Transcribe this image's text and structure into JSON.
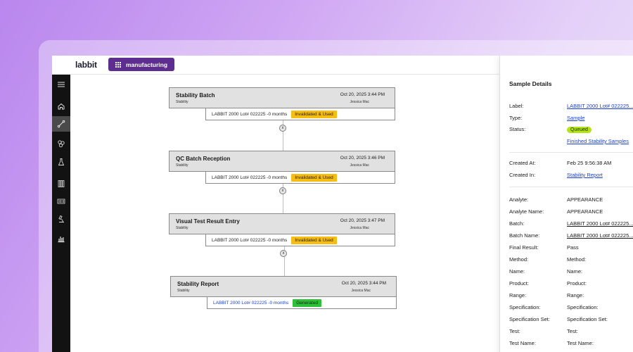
{
  "app": {
    "logo": "labbit",
    "workspace": "manufacturing"
  },
  "sidebar": {
    "items": [
      {
        "name": "menu-icon"
      },
      {
        "name": "home-icon"
      },
      {
        "name": "workflow-icon",
        "active": true
      },
      {
        "name": "molecule-icon"
      },
      {
        "name": "flask-icon"
      },
      {
        "name": "test-tubes-icon"
      },
      {
        "name": "barcode-icon"
      },
      {
        "name": "microscope-icon"
      },
      {
        "name": "report-chart-icon"
      }
    ]
  },
  "workflow": {
    "nodes": [
      {
        "title": "Stability Batch",
        "subtitle": "Stability",
        "date": "Oct 20, 2025 3:44 PM",
        "user": "Jessica Mac",
        "sample": "LABBIT 2000 Lot# 022225 -0 months",
        "status": "Invalidated & Used",
        "status_color": "#f6bd16"
      },
      {
        "title": "QC Batch Reception",
        "subtitle": "Stability",
        "date": "Oct 20, 2025 3:46 PM",
        "user": "Jessica Mac",
        "sample": "LABBIT 2000 Lot# 022225 -0 months",
        "status": "Invalidated & Used",
        "status_color": "#f6bd16"
      },
      {
        "title": "Visual Test Result Entry",
        "subtitle": "Stability",
        "date": "Oct 20, 2025 3:47 PM",
        "user": "Jessica Mac",
        "sample": "LABBIT 2000 Lot# 022225 -0 months",
        "status": "Invalidated & Used",
        "status_color": "#f6bd16"
      },
      {
        "title": "Stability Report",
        "subtitle": "Stability",
        "date": "Oct 20, 2025 3:44 PM",
        "user": "Jessica Mac",
        "sample": "LABBIT 2000 Lot# 022225 -0 months",
        "status": "Generated",
        "status_color": "#2fbf3a"
      }
    ],
    "connector_symbol": "x"
  },
  "details": {
    "title": "Sample Details",
    "label_k": "Label:",
    "label_v": "LABBIT 2000 Lot# 022225...",
    "type_k": "Type:",
    "type_v": "Sample",
    "status_k": "Status:",
    "status_v": "Queued",
    "queue_link": "Finished Stability Samples",
    "created_at_k": "Created At:",
    "created_at_v": "Feb 25 9:56:38 AM",
    "created_in_k": "Created In:",
    "created_in_v": "Stability Report",
    "analyte_k": "Analyte:",
    "analyte_v": "APPEARANCE",
    "analyte_name_k": "Analyte Name:",
    "analyte_name_v": "APPEARANCE",
    "batch_k": "Batch:",
    "batch_v": "LABBIT 2000 Lot# 022225...",
    "batch_name_k": "Batch Name:",
    "batch_name_v": "LABBIT 2000 Lot# 022225...",
    "final_result_k": "Final Result:",
    "final_result_v": "Pass",
    "method_k": "Method:",
    "method_v": "Method:",
    "name_k": "Name:",
    "name_v": "Name:",
    "product_k": "Product:",
    "product_v": "Product:",
    "range_k": "Range:",
    "range_v": "Range:",
    "specification_k": "Specification:",
    "specification_v": "Specification:",
    "specification_set_k": "Specification Set:",
    "specification_set_v": "Specification Set:",
    "test_k": "Test:",
    "test_v": "Test:",
    "test_name_k": "Test Name:",
    "test_name_v": "Test Name:"
  }
}
